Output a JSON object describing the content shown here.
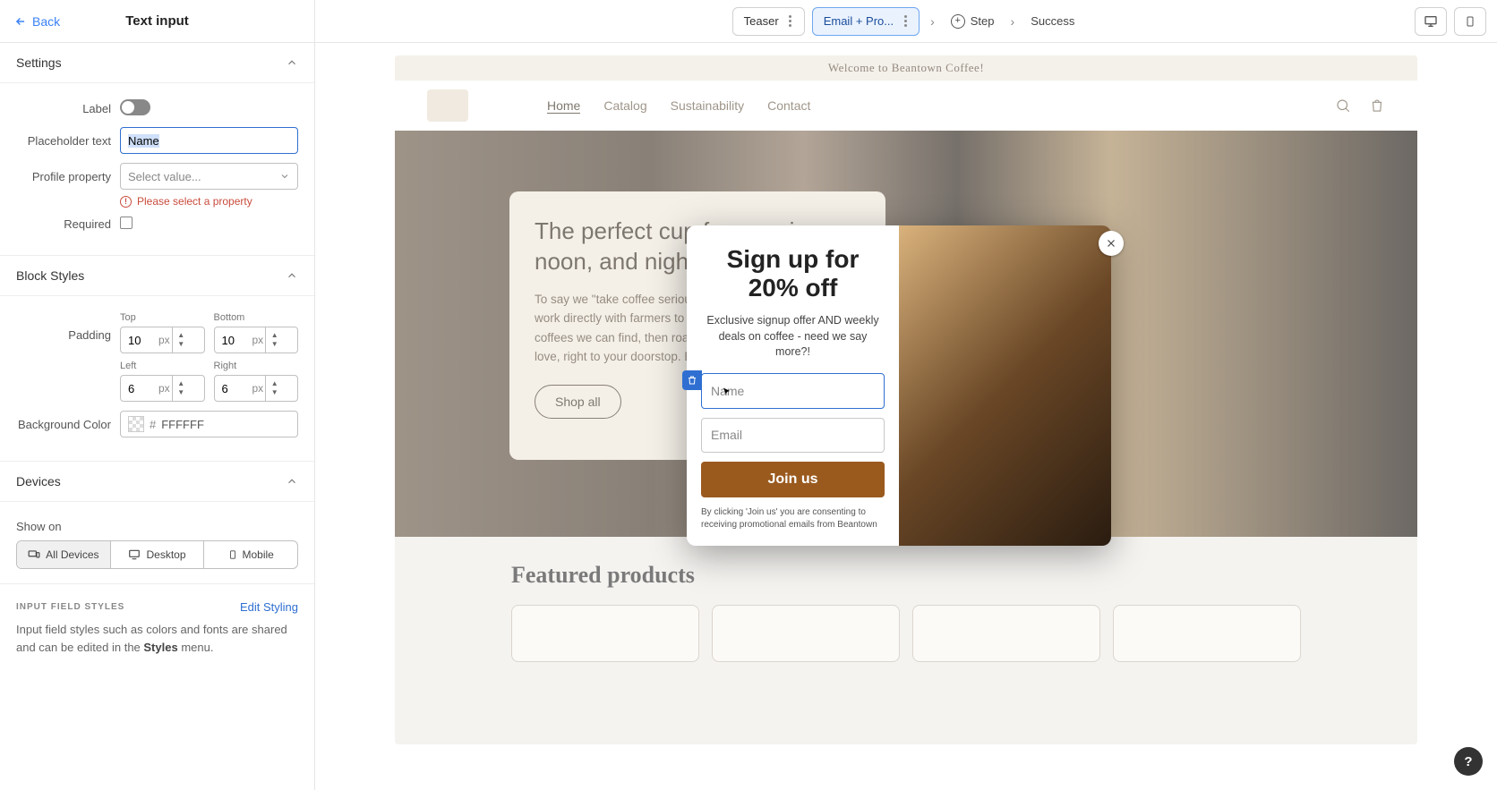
{
  "header": {
    "back": "Back",
    "title": "Text input"
  },
  "stepper": {
    "teaser": "Teaser",
    "email_pro": "Email + Pro...",
    "step": "Step",
    "success": "Success"
  },
  "settings": {
    "section_title": "Settings",
    "label_lbl": "Label",
    "placeholder_lbl": "Placeholder text",
    "placeholder_val": "Name",
    "profile_lbl": "Profile property",
    "profile_placeholder": "Select value...",
    "profile_error": "Please select a property",
    "required_lbl": "Required"
  },
  "block_styles": {
    "section_title": "Block Styles",
    "padding_lbl": "Padding",
    "top_lbl": "Top",
    "bottom_lbl": "Bottom",
    "left_lbl": "Left",
    "right_lbl": "Right",
    "top_val": "10",
    "bottom_val": "10",
    "left_val": "6",
    "right_val": "6",
    "unit": "px",
    "bgcolor_lbl": "Background Color",
    "bgcolor_val": "FFFFFF"
  },
  "devices": {
    "section_title": "Devices",
    "show_on": "Show on",
    "all": "All Devices",
    "desktop": "Desktop",
    "mobile": "Mobile"
  },
  "input_field_styles": {
    "heading": "INPUT FIELD STYLES",
    "edit": "Edit Styling",
    "desc_pre": "Input field styles such as colors and fonts are shared and can be edited in the ",
    "desc_bold": "Styles",
    "desc_post": " menu."
  },
  "preview": {
    "banner": "Welcome to Beantown Coffee!",
    "nav": {
      "home": "Home",
      "catalog": "Catalog",
      "sustain": "Sustainability",
      "contact": "Contact"
    },
    "hero": {
      "title": "The perfect cup for morning, noon, and night.",
      "body": "To say we \"take coffee seriously\" is an understatement. We work directly with farmers to source the most sustainable coffees we can find, then roast and deliver the coffee we love, right to your doorstop. Enjoy a cup in our cafe.",
      "cta": "Shop all"
    },
    "featured_title": "Featured products"
  },
  "popup": {
    "title_l1": "Sign up for",
    "title_l2": "20% off",
    "sub": "Exclusive signup offer AND weekly deals on coffee - need we say more?!",
    "name_ph": "Name",
    "email_ph": "Email",
    "cta": "Join us",
    "fine": "By clicking 'Join us' you are consenting to receiving promotional emails from Beantown"
  },
  "help": "?"
}
